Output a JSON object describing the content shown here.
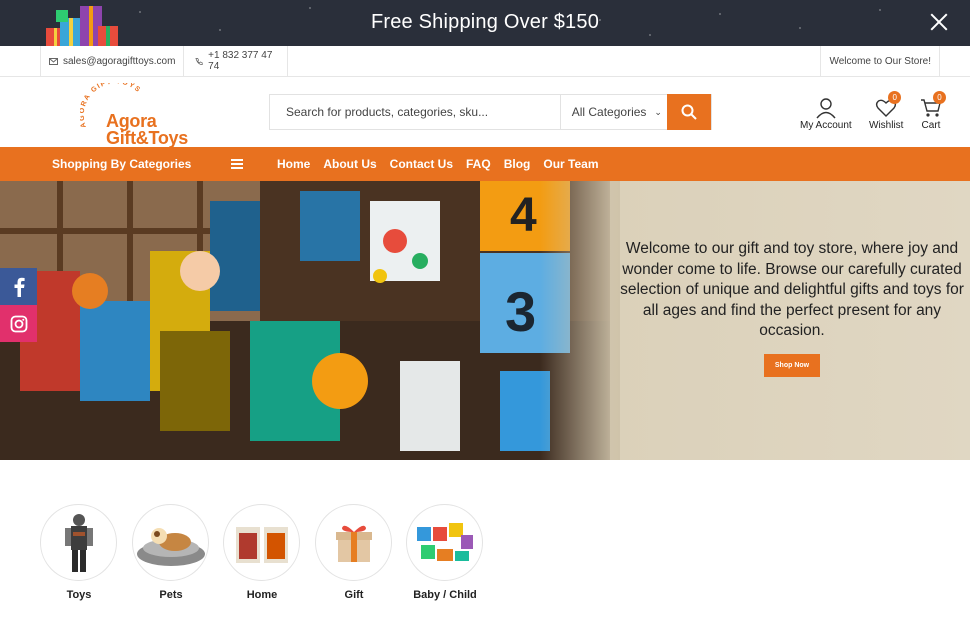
{
  "promo": {
    "text": "Free Shipping Over $150"
  },
  "infobar": {
    "email": "sales@agoragifttoys.com",
    "phone": "+1 832 377 47 74",
    "welcome": "Welcome to Our Store!"
  },
  "logo": {
    "arc_text": "AGORA GIFT TOYS",
    "line1": "Agora",
    "line2": "Gift&Toys"
  },
  "search": {
    "placeholder": "Search for products, categories, sku...",
    "category": "All Categories"
  },
  "header": {
    "account_label": "My Account",
    "wishlist_label": "Wishlist",
    "wishlist_count": "0",
    "cart_label": "Cart",
    "cart_count": "0"
  },
  "nav": {
    "categories_label": "Shopping By Categories",
    "links": [
      "Home",
      "About Us",
      "Contact Us",
      "FAQ",
      "Blog",
      "Our Team"
    ]
  },
  "hero": {
    "copy": "Welcome to our gift and toy store, where joy and wonder come to life. Browse our carefully curated selection of unique and delightful gifts and toys for all ages and find the perfect present for any occasion.",
    "button": "Shop Now",
    "scene_numbers": [
      "4",
      "3"
    ]
  },
  "categories": [
    "Toys",
    "Pets",
    "Home",
    "Gift",
    "Baby / Child"
  ],
  "colors": {
    "accent": "#e8711f",
    "promo_bg": "#2a2f3a",
    "facebook": "#3b5998",
    "instagram": "#e1306c"
  }
}
